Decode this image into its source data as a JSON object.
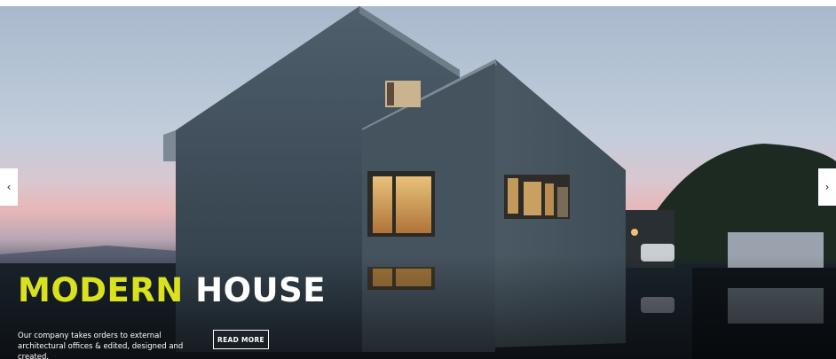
{
  "hero": {
    "title_accent": "MODERN",
    "title_main": "HOUSE",
    "description": "Our company takes orders to external architectural offices & edited, designed and created.",
    "button_label": "READ MORE",
    "accent_color": "#d9e21c"
  },
  "slider": {
    "prev_icon": "chevron-left-icon",
    "next_icon": "chevron-right-icon"
  }
}
